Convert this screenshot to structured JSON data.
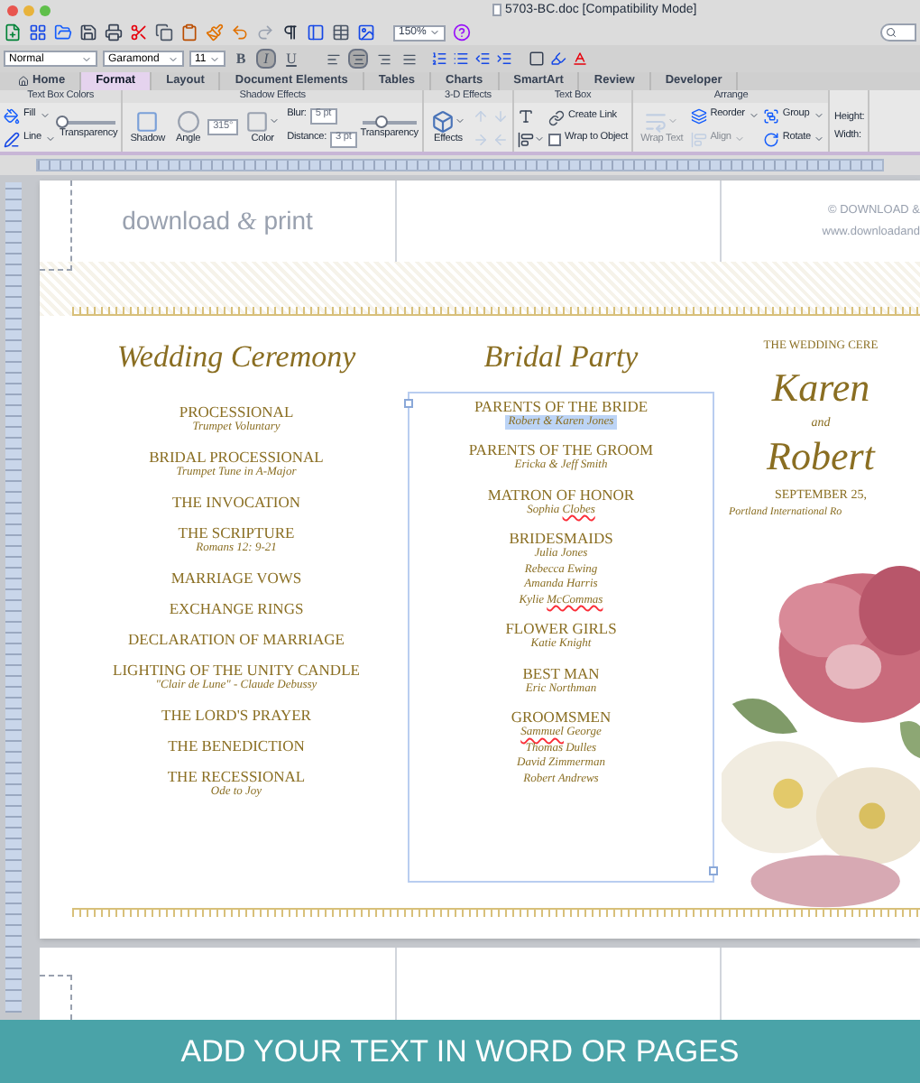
{
  "window": {
    "title": "5703-BC.doc [Compatibility Mode]"
  },
  "toolbar": {
    "zoom": "150%"
  },
  "format_bar": {
    "style": "Normal",
    "font": "Garamond",
    "size": "11",
    "styles": [
      {
        "label": "B",
        "selected": false
      },
      {
        "label": "I",
        "selected": true
      },
      {
        "label": "U",
        "selected": false
      }
    ],
    "alignments": [
      {
        "selected": false
      },
      {
        "selected": true
      },
      {
        "selected": false
      },
      {
        "selected": false
      }
    ]
  },
  "tabs": [
    {
      "label": "Home",
      "selected": false
    },
    {
      "label": "Format",
      "selected": true
    },
    {
      "label": "Layout",
      "selected": false
    },
    {
      "label": "Document Elements",
      "selected": false
    },
    {
      "label": "Tables",
      "selected": false
    },
    {
      "label": "Charts",
      "selected": false
    },
    {
      "label": "SmartArt",
      "selected": false
    },
    {
      "label": "Review",
      "selected": false
    },
    {
      "label": "Developer",
      "selected": false
    }
  ],
  "ribbon": [
    {
      "title": "Text Box Colors",
      "columns": [
        [
          {
            "kind": "small",
            "label": "Fill",
            "disabled": false
          },
          {
            "kind": "small",
            "label": "Line",
            "disabled": false
          }
        ],
        [
          {
            "kind": "slider",
            "label": "Transparency",
            "level": 0.0,
            "disabled": false
          }
        ]
      ]
    },
    {
      "title": "Shadow Effects",
      "columns": [
        [
          {
            "kind": "big",
            "label": "Shadow",
            "disabled": false
          }
        ],
        [
          {
            "kind": "big",
            "label": "Angle",
            "disabled": false
          }
        ],
        [
          {
            "kind": "field",
            "value": "315°",
            "disabled": false
          }
        ],
        [
          {
            "kind": "big",
            "label": "Color",
            "disabled": false
          }
        ],
        [
          {
            "kind": "field",
            "label": "Blur:",
            "value": "5 pt",
            "disabled": false
          },
          {
            "kind": "field",
            "label": "Distance:",
            "value": "3 pt",
            "disabled": false
          }
        ],
        [
          {
            "kind": "slider",
            "label": "Transparency",
            "level": 0.35,
            "disabled": false
          }
        ]
      ]
    },
    {
      "title": "3-D Effects",
      "columns": [
        [
          {
            "kind": "big",
            "label": "Effects",
            "disabled": false
          }
        ],
        [
          {
            "kind": "tool",
            "disabled": true
          },
          {
            "kind": "tool",
            "disabled": true
          }
        ],
        [
          {
            "kind": "tool",
            "disabled": true
          },
          {
            "kind": "tool",
            "disabled": true
          }
        ]
      ]
    },
    {
      "title": "Text Box",
      "columns": [
        [
          {
            "kind": "tool",
            "disabled": false
          },
          {
            "kind": "tool",
            "disabled": false
          }
        ],
        [
          {
            "kind": "small",
            "label": "Create Link",
            "disabled": false
          },
          {
            "kind": "checkbox",
            "label": "Wrap to Object",
            "checked": false,
            "disabled": false
          }
        ]
      ]
    },
    {
      "title": "Arrange",
      "columns": [
        [
          {
            "kind": "big",
            "label": "Wrap Text",
            "disabled": true
          }
        ],
        [
          {
            "kind": "small",
            "label": "Reorder",
            "disabled": false
          },
          {
            "kind": "small",
            "label": "Align",
            "disabled": true
          }
        ],
        [
          {
            "kind": "small",
            "label": "Group",
            "disabled": false
          },
          {
            "kind": "small",
            "label": "Rotate",
            "disabled": false
          }
        ]
      ]
    },
    {
      "columns": [
        [
          {
            "kind": "field",
            "label": "Height:",
            "disabled": false
          },
          {
            "kind": "field",
            "label": "Width:",
            "disabled": false
          }
        ]
      ]
    }
  ],
  "document": {
    "logo": {
      "before": "download",
      "amp": "&",
      "after": "print"
    },
    "copyright": "© DOWNLOAD &",
    "website": "www.downloadand",
    "ceremony": {
      "title": "Wedding Ceremony",
      "items": [
        {
          "heading": "PROCESSIONAL",
          "detail": "Trumpet Voluntary"
        },
        {
          "heading": "BRIDAL PROCESSIONAL",
          "detail": "Trumpet Tune in A-Major"
        },
        {
          "heading": "THE INVOCATION"
        },
        {
          "heading": "THE SCRIPTURE",
          "detail": "Romans 12: 9-21"
        },
        {
          "heading": "MARRIAGE VOWS"
        },
        {
          "heading": "EXCHANGE RINGS"
        },
        {
          "heading": "DECLARATION OF MARRIAGE"
        },
        {
          "heading": "LIGHTING OF THE UNITY CANDLE",
          "detail": "\"Clair de Lune\" - Claude Debussy"
        },
        {
          "heading": "THE LORD'S PRAYER"
        },
        {
          "heading": "THE BENEDICTION"
        },
        {
          "heading": "THE RECESSIONAL",
          "detail": "Ode to Joy"
        }
      ]
    },
    "bridal_party": {
      "title": "Bridal Party",
      "sections": [
        {
          "heading": "PARENTS OF THE BRIDE",
          "names": [
            {
              "selected": true,
              "parts": [
                {
                  "text": "Robert & Karen Jones",
                  "misspelled": false
                }
              ]
            }
          ]
        },
        {
          "heading": "PARENTS OF THE GROOM",
          "names": [
            {
              "selected": false,
              "parts": [
                {
                  "text": "Ericka & Jeff Smith",
                  "misspelled": false
                }
              ]
            }
          ]
        },
        {
          "heading": "MATRON OF HONOR",
          "names": [
            {
              "selected": false,
              "parts": [
                {
                  "text": "Sophia",
                  "misspelled": false
                },
                {
                  "text": "Clobes",
                  "misspelled": true
                }
              ]
            }
          ]
        },
        {
          "heading": "BRIDESMAIDS",
          "names": [
            {
              "selected": false,
              "parts": [
                {
                  "text": "Julia Jones",
                  "misspelled": false
                }
              ]
            },
            {
              "selected": false,
              "parts": [
                {
                  "text": "Rebecca Ewing",
                  "misspelled": false
                }
              ]
            },
            {
              "selected": false,
              "parts": [
                {
                  "text": "Amanda Harris",
                  "misspelled": false
                }
              ]
            },
            {
              "selected": false,
              "parts": [
                {
                  "text": "Kylie",
                  "misspelled": false
                },
                {
                  "text": "McCommas",
                  "misspelled": true
                }
              ]
            }
          ]
        },
        {
          "heading": "FLOWER GIRLS",
          "names": [
            {
              "selected": false,
              "parts": [
                {
                  "text": "Katie Knight",
                  "misspelled": false
                }
              ]
            }
          ]
        },
        {
          "heading": "BEST MAN",
          "names": [
            {
              "selected": false,
              "parts": [
                {
                  "text": "Eric Northman",
                  "misspelled": false
                }
              ]
            }
          ]
        },
        {
          "heading": "GROOMSMEN",
          "names": [
            {
              "selected": false,
              "parts": [
                {
                  "text": "Sammuel",
                  "misspelled": true
                },
                {
                  "text": "George",
                  "misspelled": false
                }
              ]
            },
            {
              "selected": false,
              "parts": [
                {
                  "text": "Thomas Dulles",
                  "misspelled": false
                }
              ]
            },
            {
              "selected": false,
              "parts": [
                {
                  "text": "David Zimmerman",
                  "misspelled": false
                }
              ]
            },
            {
              "selected": false,
              "parts": [
                {
                  "text": "Robert Andrews",
                  "misspelled": false
                }
              ]
            }
          ]
        }
      ]
    },
    "invitation": {
      "eyebrow": "THE WEDDING CERE",
      "bride": "Karen",
      "joiner": "and",
      "groom": "Robert",
      "date": "SEPTEMBER 25,",
      "venue": "Portland International Ro"
    }
  },
  "banner": "ADD YOUR TEXT IN WORD OR PAGES"
}
